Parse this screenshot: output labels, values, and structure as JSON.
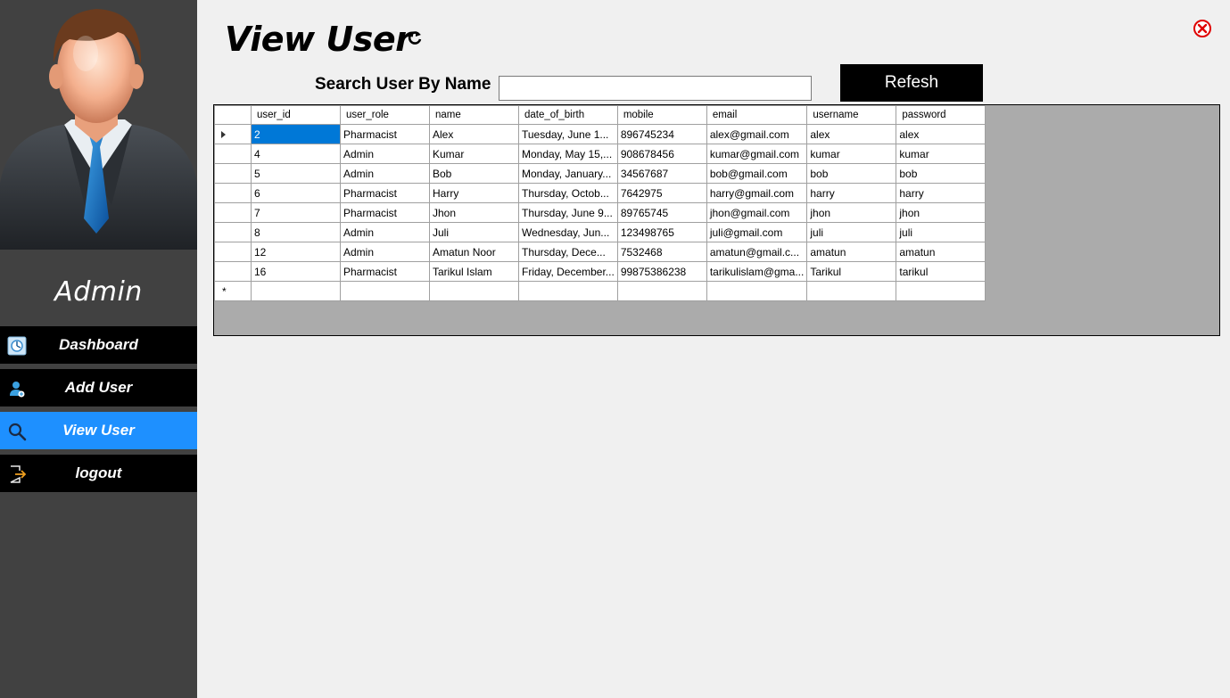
{
  "sidebar": {
    "user_name": "Admin",
    "nav_items": [
      {
        "label": "Dashboard",
        "icon": "dashboard-icon",
        "active": false
      },
      {
        "label": "Add User",
        "icon": "add-user-icon",
        "active": false
      },
      {
        "label": "View User",
        "icon": "search-icon",
        "active": true
      },
      {
        "label": "logout",
        "icon": "logout-icon",
        "active": false
      }
    ]
  },
  "header": {
    "title": "View User",
    "search_label": "Search User By Name",
    "search_value": "",
    "refresh_label": "Refesh"
  },
  "grid": {
    "columns": [
      "user_id",
      "user_role",
      "name",
      "date_of_birth",
      "mobile",
      "email",
      "username",
      "password"
    ],
    "rows": [
      [
        "2",
        "Pharmacist",
        "Alex",
        "Tuesday, June 1...",
        "896745234",
        "alex@gmail.com",
        "alex",
        "alex"
      ],
      [
        "4",
        "Admin",
        "Kumar",
        "Monday, May 15,...",
        "908678456",
        "kumar@gmail.com",
        "kumar",
        "kumar"
      ],
      [
        "5",
        "Admin",
        "Bob",
        "Monday, January...",
        "34567687",
        "bob@gmail.com",
        "bob",
        "bob"
      ],
      [
        "6",
        "Pharmacist",
        "Harry",
        "Thursday, Octob...",
        "7642975",
        "harry@gmail.com",
        "harry",
        "harry"
      ],
      [
        "7",
        "Pharmacist",
        "Jhon",
        "Thursday, June 9...",
        "89765745",
        "jhon@gmail.com",
        "jhon",
        "jhon"
      ],
      [
        "8",
        "Admin",
        "Juli",
        "Wednesday, Jun...",
        "123498765",
        "juli@gmail.com",
        "juli",
        "juli"
      ],
      [
        "12",
        "Admin",
        "Amatun Noor",
        "Thursday, Dece...",
        "7532468",
        "amatun@gmail.c...",
        "amatun",
        "amatun"
      ],
      [
        "16",
        "Pharmacist",
        "Tarikul Islam",
        "Friday, December...",
        "99875386238",
        "tarikulislam@gma...",
        "Tarikul",
        "tarikul"
      ]
    ],
    "new_row_marker": "*"
  },
  "colors": {
    "sidebar_bg": "#414141",
    "nav_bg": "#000000",
    "nav_active_bg": "#1e90ff",
    "page_bg": "#f0f0f0",
    "grid_bg": "#ababab",
    "selection": "#0078d7",
    "close": "#e00000"
  }
}
